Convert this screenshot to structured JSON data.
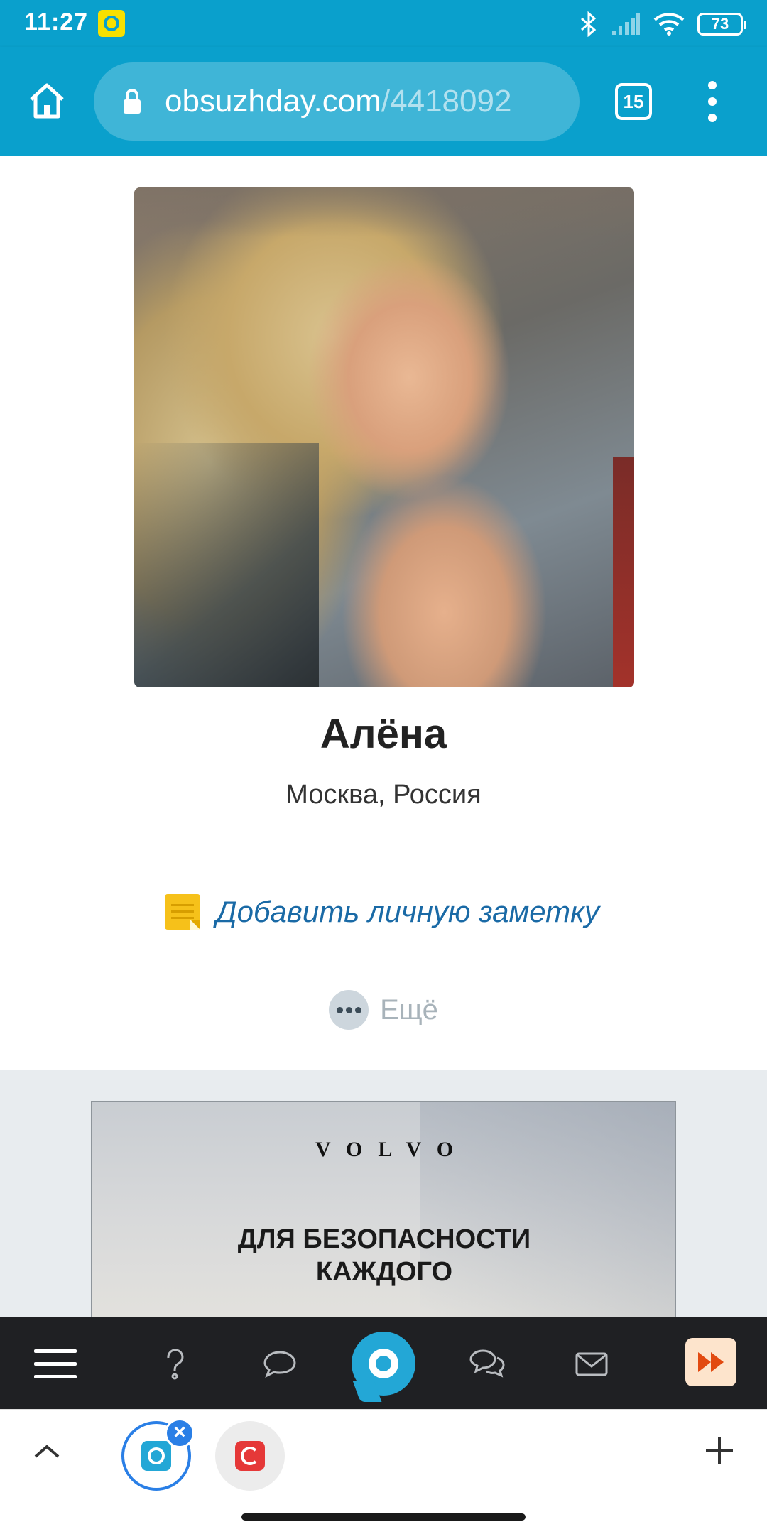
{
  "status_bar": {
    "time": "11:27",
    "battery": "73",
    "icons": [
      "bluetooth-icon",
      "signal-icon",
      "wifi-icon",
      "battery-icon"
    ]
  },
  "browser": {
    "url_domain": "obsuzhday.com",
    "url_path": "/4418092",
    "tab_count": "15"
  },
  "profile": {
    "name": "Алёна",
    "location": "Москва, Россия",
    "note_link": "Добавить личную заметку",
    "more_label": "Ещё"
  },
  "ad": {
    "brand": "VOLVO",
    "headline_line1": "ДЛЯ БЕЗОПАСНОСТИ",
    "headline_line2": "КАЖДОГО"
  },
  "site_nav": {
    "items": [
      "menu-icon",
      "question-icon",
      "comment-icon",
      "home-logo-icon",
      "chats-icon",
      "mail-icon",
      "fast-forward-icon"
    ]
  },
  "colors": {
    "brand": "#0aa0cc",
    "link": "#1a6aa6",
    "nav_bg": "#1f2023"
  }
}
